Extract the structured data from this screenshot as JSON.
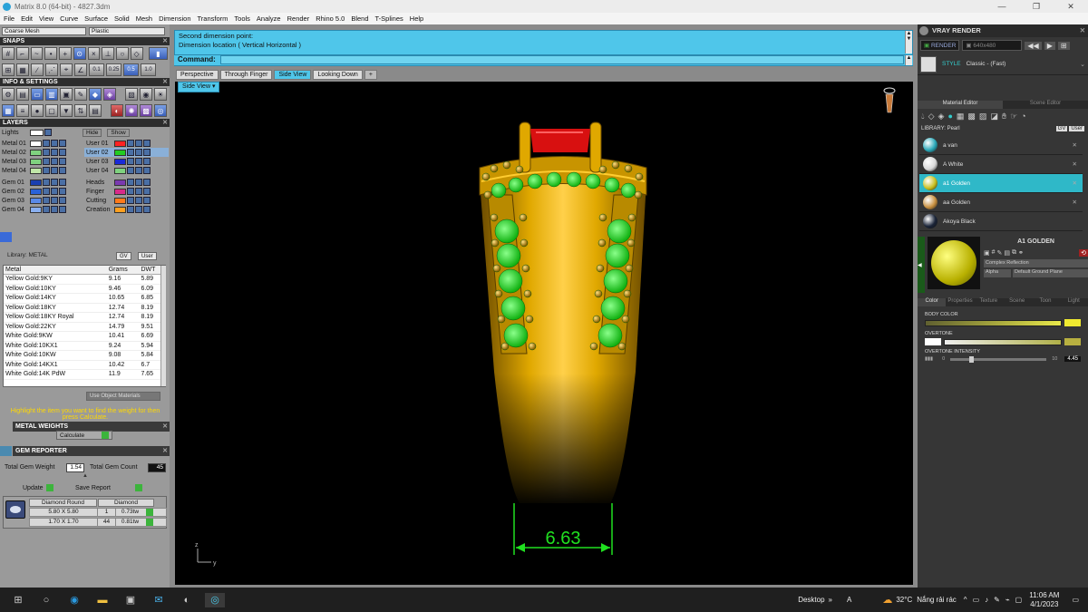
{
  "window": {
    "title": "Matrix 8.0 (64-bit) - 4827.3dm",
    "controls": [
      "—",
      "❐",
      "✕"
    ]
  },
  "menu": [
    "File",
    "Edit",
    "View",
    "Curve",
    "Surface",
    "Solid",
    "Mesh",
    "Dimension",
    "Transform",
    "Tools",
    "Analyze",
    "Render",
    "Rhino 5.0",
    "Blend",
    "T-Splines",
    "Help"
  ],
  "left": {
    "mesh_select": "Coarse Mesh",
    "material_select": "Plastic",
    "snaps_title": "SNAPS",
    "snap_values": [
      "0.1",
      "0.25",
      "0.5",
      "1.0"
    ],
    "info_title": "INFO & SETTINGS",
    "layers_title": "LAYERS",
    "lights_label": "Lights",
    "hide_label": "Hide",
    "show_label": "Show",
    "layers_left": [
      {
        "name": "Metal 01",
        "color": "#ffffff"
      },
      {
        "name": "Metal 02",
        "color": "#7fd27f"
      },
      {
        "name": "Metal 03",
        "color": "#7fd27f"
      },
      {
        "name": "Metal 04",
        "color": "#c0e6a8"
      },
      {
        "name": "Gem 01",
        "color": "#1a3fb0"
      },
      {
        "name": "Gem 02",
        "color": "#2a62d8"
      },
      {
        "name": "Gem 03",
        "color": "#5a8ae8"
      },
      {
        "name": "Gem 04",
        "color": "#8ab0f0"
      }
    ],
    "layers_right": [
      {
        "name": "User 01",
        "color": "#ff2222"
      },
      {
        "name": "User 02",
        "color": "#22cc22"
      },
      {
        "name": "User 03",
        "color": "#1a2ad8"
      },
      {
        "name": "User 04",
        "color": "#7fd27f"
      },
      {
        "name": "Heads",
        "color": "#7a3ab0"
      },
      {
        "name": "Finger",
        "color": "#d82a8a"
      },
      {
        "name": "Cutting",
        "color": "#ff7a1a"
      },
      {
        "name": "Creation",
        "color": "#ffa020"
      }
    ],
    "metal_weights": {
      "title": "METAL WEIGHTS",
      "library_label": "Library: METAL",
      "gv": "GV",
      "user": "User",
      "columns": [
        "Metal",
        "Grams",
        "DWT"
      ],
      "rows": [
        [
          "Yellow Gold:9KY",
          "9.16",
          "5.89"
        ],
        [
          "Yellow Gold:10KY",
          "9.46",
          "6.09"
        ],
        [
          "Yellow Gold:14KY",
          "10.65",
          "6.85"
        ],
        [
          "Yellow Gold:18KY",
          "12.74",
          "8.19"
        ],
        [
          "Yellow Gold:18KY Royal",
          "12.74",
          "8.19"
        ],
        [
          "Yellow Gold:22KY",
          "14.79",
          "9.51"
        ],
        [
          "White Gold:9KW",
          "10.41",
          "6.69"
        ],
        [
          "White Gold:10KX1",
          "9.24",
          "5.94"
        ],
        [
          "White Gold:10KW",
          "9.08",
          "5.84"
        ],
        [
          "White Gold:14KX1",
          "10.42",
          "6.7"
        ],
        [
          "White Gold:14K PdW",
          "11.9",
          "7.65"
        ]
      ],
      "use_objects": "Use Object Materials",
      "hint": "Highlight the item you want to find the weight for then press Calculate.",
      "calculate": "Calculate"
    },
    "gem_reporter": {
      "title": "GEM REPORTER",
      "total_weight_label": "Total Gem Weight",
      "total_weight": "1.54",
      "total_count_label": "Total Gem Count",
      "total_count": "45",
      "update": "Update",
      "save_report": "Save Report",
      "columns": [
        "Diamond Round",
        "Diamond"
      ],
      "rows": [
        [
          "5.80 X 5.80",
          "1",
          "0.73tw"
        ],
        [
          "1.70 X 1.70",
          "44",
          "0.81tw"
        ]
      ]
    }
  },
  "command": {
    "line1": "Second dimension point:",
    "line2": "Dimension location ( Vertical  Horizontal )",
    "prompt": "Command:"
  },
  "views": {
    "tabs": [
      "Perspective",
      "Through Finger",
      "Side View",
      "Looking Down"
    ],
    "active": "Side View",
    "add": "+",
    "label": "Side View ▾"
  },
  "viewport": {
    "dimension": "6.63",
    "axis_z": "z",
    "axis_y": "y"
  },
  "right": {
    "title": "VRAY RENDER",
    "render_btn": "RENDER",
    "resolution": "640x480",
    "style_label": "STYLE",
    "style_value": "Classic - (Fast)",
    "tabs": [
      "Material Editor",
      "Scene Editor"
    ],
    "library_label": "LIBRARY: Pearl",
    "materials": [
      {
        "name": "a van",
        "color": "#2aa8b8"
      },
      {
        "name": "A White",
        "color": "#d8d8d8"
      },
      {
        "name": "a1 Golden",
        "color": "#c8c020"
      },
      {
        "name": "aa Golden",
        "color": "#c89040"
      },
      {
        "name": "Akoya Black",
        "color": "#1a2438"
      }
    ],
    "selected_name": "A1 GOLDEN",
    "reflection": "Complex Reflection",
    "alpha_label": "Alpha",
    "ground": "Default Ground Plane",
    "sub_tabs": [
      "Color",
      "Properties",
      "Texture",
      "Scene",
      "Toon",
      "Light"
    ],
    "body_color_label": "BODY COLOR",
    "overtone_label": "OVERTONE",
    "overtone_intensity_label": "OVERTONE INTENSITY",
    "intensity_min": "0",
    "intensity_max": "10",
    "intensity_value": "4.45",
    "body_color": "#f0ea30"
  },
  "taskbar": {
    "desktop": "Desktop",
    "temp": "32°C",
    "weather": "Nắng rải rác",
    "time": "11:06 AM",
    "date": "4/1/2023"
  }
}
